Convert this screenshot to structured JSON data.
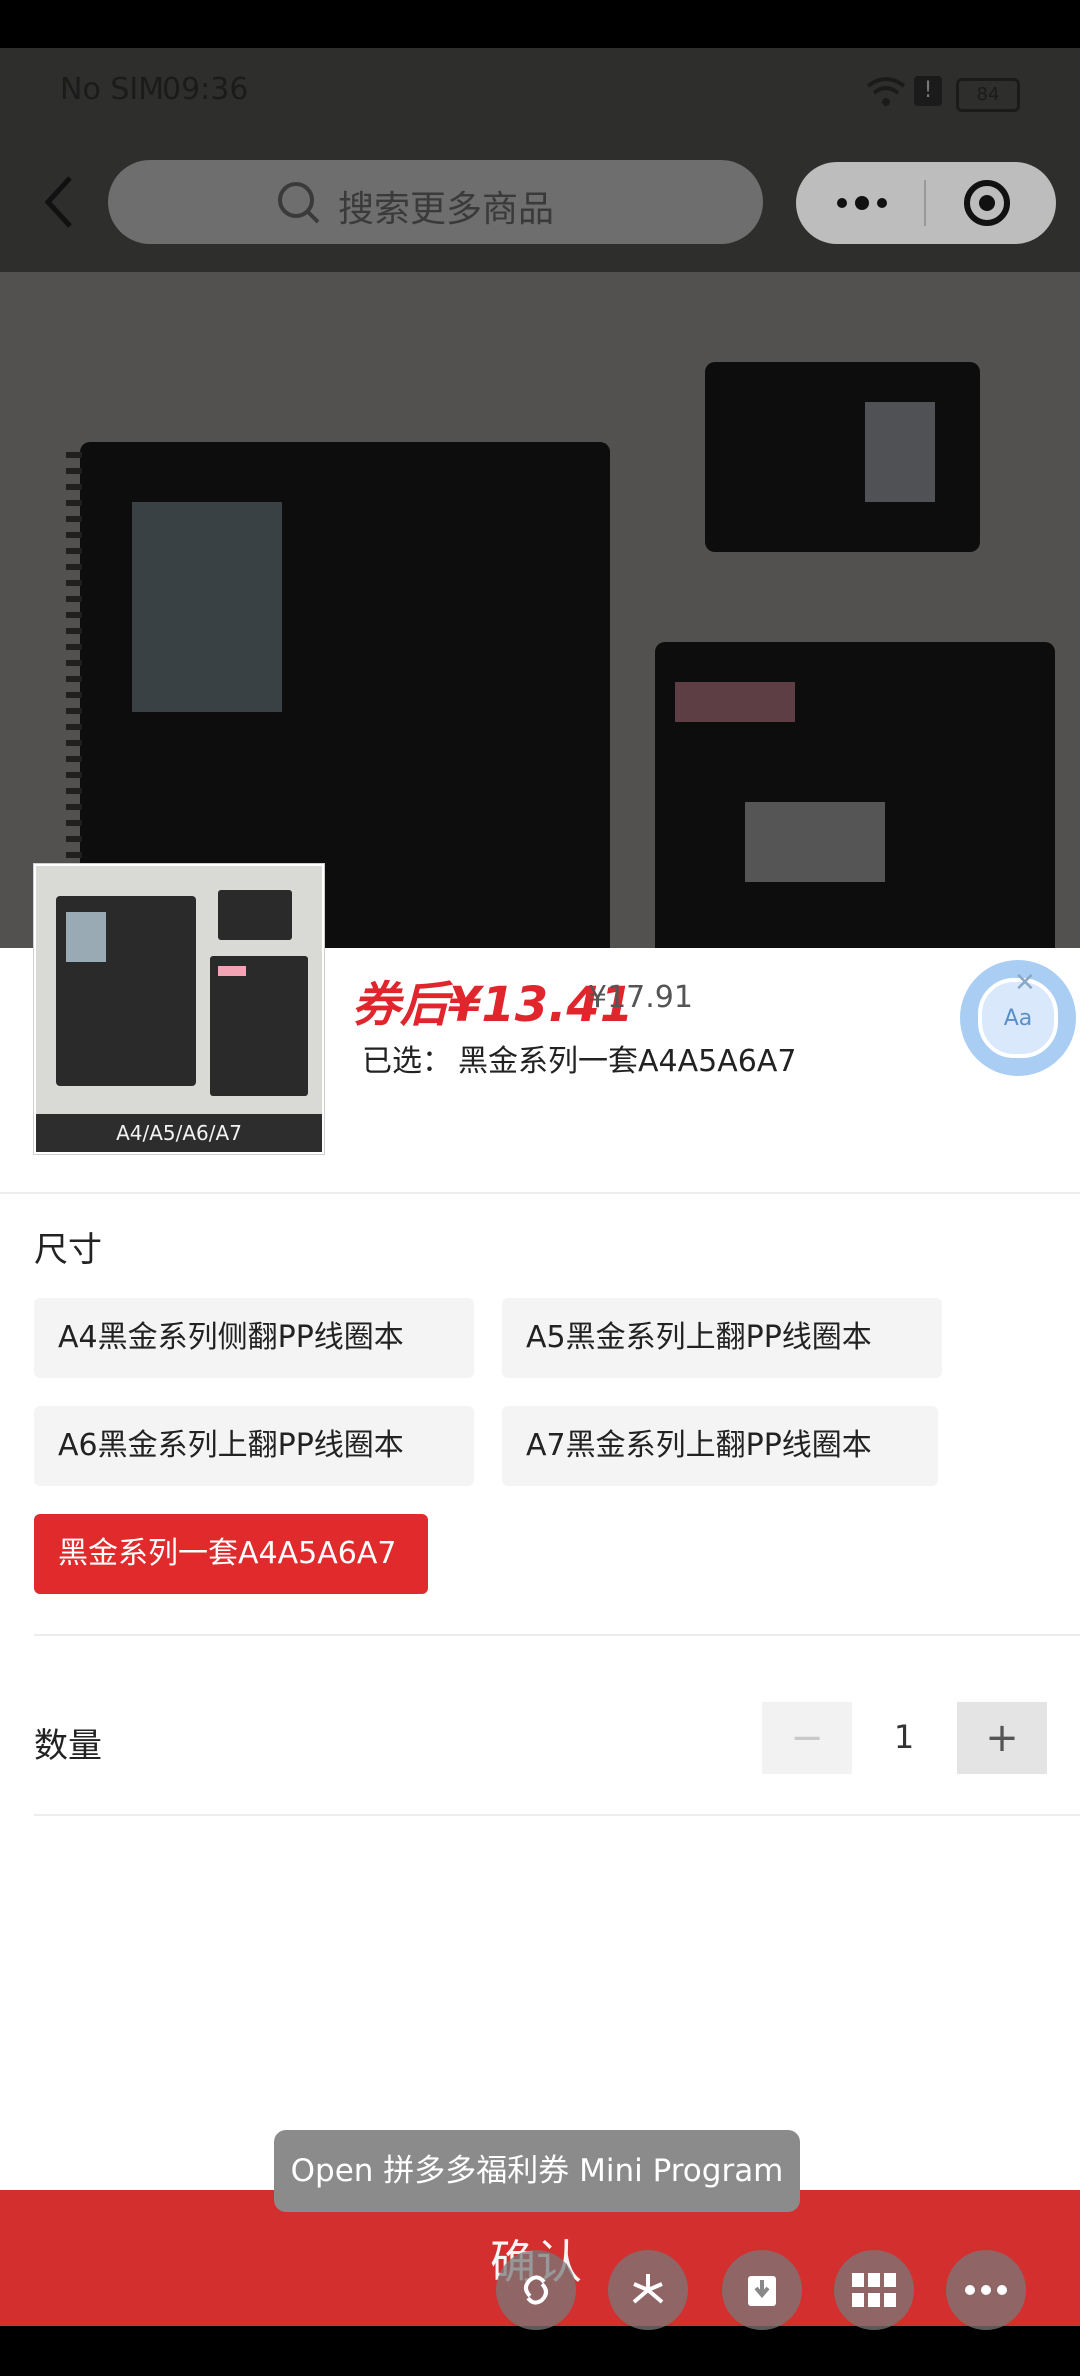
{
  "status": {
    "carrier": "No SIM",
    "time": "09:36",
    "battery": "84"
  },
  "search": {
    "placeholder": "搜索更多商品"
  },
  "product": {
    "thumb_caption": "A4/A5/A6/A7",
    "price_after_coupon": "券后¥13.41",
    "original_price": "¥17.91",
    "selected_label": "已选：",
    "selected_value": "黑金系列一套A4A5A6A7"
  },
  "size": {
    "title": "尺寸",
    "options": [
      {
        "label": "A4黑金系列侧翻PP线圈本",
        "active": false
      },
      {
        "label": "A5黑金系列上翻PP线圈本",
        "active": false
      },
      {
        "label": "A6黑金系列上翻PP线圈本",
        "active": false
      },
      {
        "label": "A7黑金系列上翻PP线圈本",
        "active": false
      },
      {
        "label": "黑金系列一套A4A5A6A7",
        "active": true
      }
    ]
  },
  "quantity": {
    "label": "数量",
    "value": "1",
    "minus": "−",
    "plus": "+"
  },
  "confirm": {
    "label": "确认"
  },
  "toast": {
    "text": "Open 拼多多福利券 Mini Program"
  },
  "colors": {
    "accent": "#e12a2c",
    "confirm_bg": "#d32f2f"
  },
  "icons": [
    "back-icon",
    "search-icon",
    "more-icon",
    "target-icon",
    "font-size-icon",
    "close-icon",
    "share-link-icon",
    "star-burst-icon",
    "download-icon",
    "grid-icon",
    "ellipsis-icon"
  ]
}
